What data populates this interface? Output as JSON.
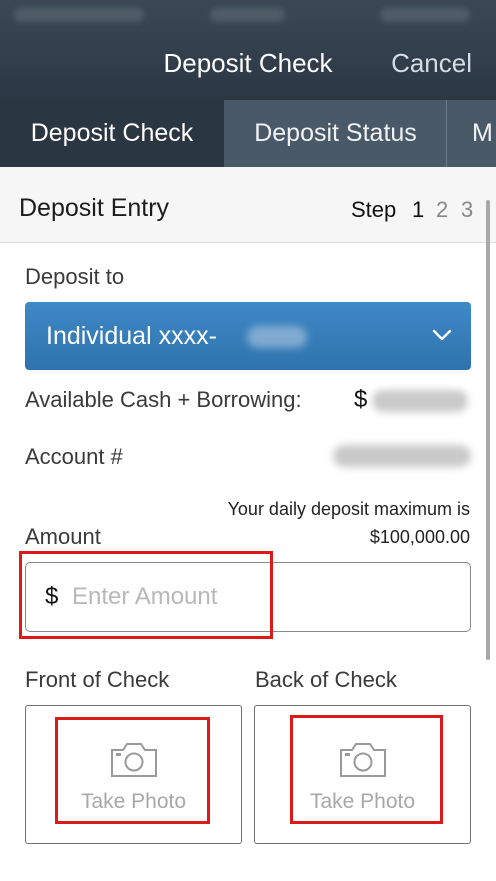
{
  "nav": {
    "title": "Deposit Check",
    "cancel_label": "Cancel"
  },
  "tabs": [
    {
      "label": "Deposit Check",
      "active": true
    },
    {
      "label": "Deposit Status",
      "active": false
    },
    {
      "label": "M",
      "active": false
    }
  ],
  "step_header": {
    "title": "Deposit Entry",
    "step_label": "Step",
    "steps": [
      "1",
      "2",
      "3"
    ],
    "current_step": "1"
  },
  "form": {
    "deposit_to_label": "Deposit to",
    "account_select_value": "Individual xxxx-",
    "available_label": "Available Cash + Borrowing:",
    "available_currency": "$",
    "account_number_label": "Account #",
    "daily_max_line1": "Your daily deposit maximum is",
    "daily_max_line2": "$100,000.00",
    "amount_label": "Amount",
    "amount_currency": "$",
    "amount_value": "",
    "amount_placeholder": "Enter Amount",
    "front_label": "Front of Check",
    "back_label": "Back of Check",
    "take_photo_label": "Take Photo"
  },
  "icons": {
    "dropdown": "chevron-down-icon",
    "photo": "camera-icon"
  },
  "colors": {
    "header_bg": "#34414e",
    "tab_bar_bg": "#4a5968",
    "tab_active_bg": "#2b3643",
    "dropdown_bg": "#3580bf",
    "highlight": "#dd1a1a"
  }
}
